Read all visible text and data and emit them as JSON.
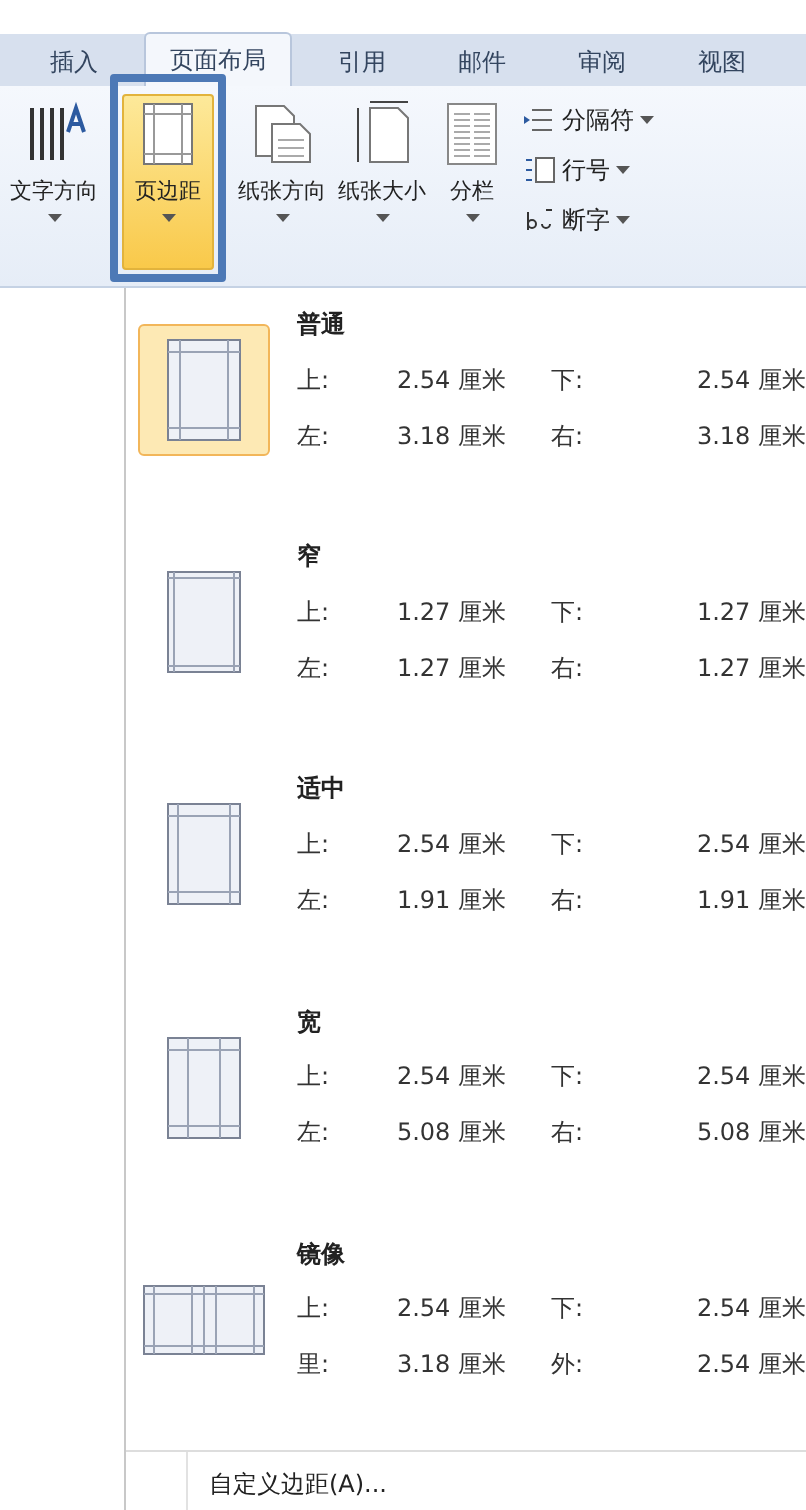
{
  "tabs": [
    {
      "label": "插入",
      "selected": false
    },
    {
      "label": "页面布局",
      "selected": true
    },
    {
      "label": "引用",
      "selected": false
    },
    {
      "label": "邮件",
      "selected": false
    },
    {
      "label": "审阅",
      "selected": false
    },
    {
      "label": "视图",
      "selected": false
    }
  ],
  "ribbon": {
    "buttons": [
      {
        "label": "文字方向",
        "kind": "text-direction",
        "selected": false
      },
      {
        "label": "页边距",
        "kind": "margins",
        "selected": true
      },
      {
        "label": "纸张方向",
        "kind": "orientation",
        "selected": false
      },
      {
        "label": "纸张大小",
        "kind": "size",
        "selected": false
      },
      {
        "label": "分栏",
        "kind": "columns",
        "selected": false
      }
    ],
    "small_buttons": [
      {
        "label": "分隔符",
        "kind": "breaks"
      },
      {
        "label": "行号",
        "kind": "line-numbers"
      },
      {
        "label": "断字",
        "kind": "hyphenation"
      }
    ]
  },
  "margins_menu": {
    "items": [
      {
        "name": "普通",
        "kind": "normal",
        "selected": true,
        "rows": [
          [
            "上:",
            "2.54 厘米",
            "下:",
            "2.54 厘米"
          ],
          [
            "左:",
            "3.18 厘米",
            "右:",
            "3.18 厘米"
          ]
        ]
      },
      {
        "name": "窄",
        "kind": "narrow",
        "selected": false,
        "rows": [
          [
            "上:",
            "1.27 厘米",
            "下:",
            "1.27 厘米"
          ],
          [
            "左:",
            "1.27 厘米",
            "右:",
            "1.27 厘米"
          ]
        ]
      },
      {
        "name": "适中",
        "kind": "moderate",
        "selected": false,
        "rows": [
          [
            "上:",
            "2.54 厘米",
            "下:",
            "2.54 厘米"
          ],
          [
            "左:",
            "1.91 厘米",
            "右:",
            "1.91 厘米"
          ]
        ]
      },
      {
        "name": "宽",
        "kind": "wide",
        "selected": false,
        "rows": [
          [
            "上:",
            "2.54 厘米",
            "下:",
            "2.54 厘米"
          ],
          [
            "左:",
            "5.08 厘米",
            "右:",
            "5.08 厘米"
          ]
        ]
      },
      {
        "name": "镜像",
        "kind": "mirrored",
        "selected": false,
        "rows": [
          [
            "上:",
            "2.54 厘米",
            "下:",
            "2.54 厘米"
          ],
          [
            "里:",
            "3.18 厘米",
            "外:",
            "2.54 厘米"
          ]
        ]
      }
    ],
    "custom": "自定义边距(A)..."
  }
}
